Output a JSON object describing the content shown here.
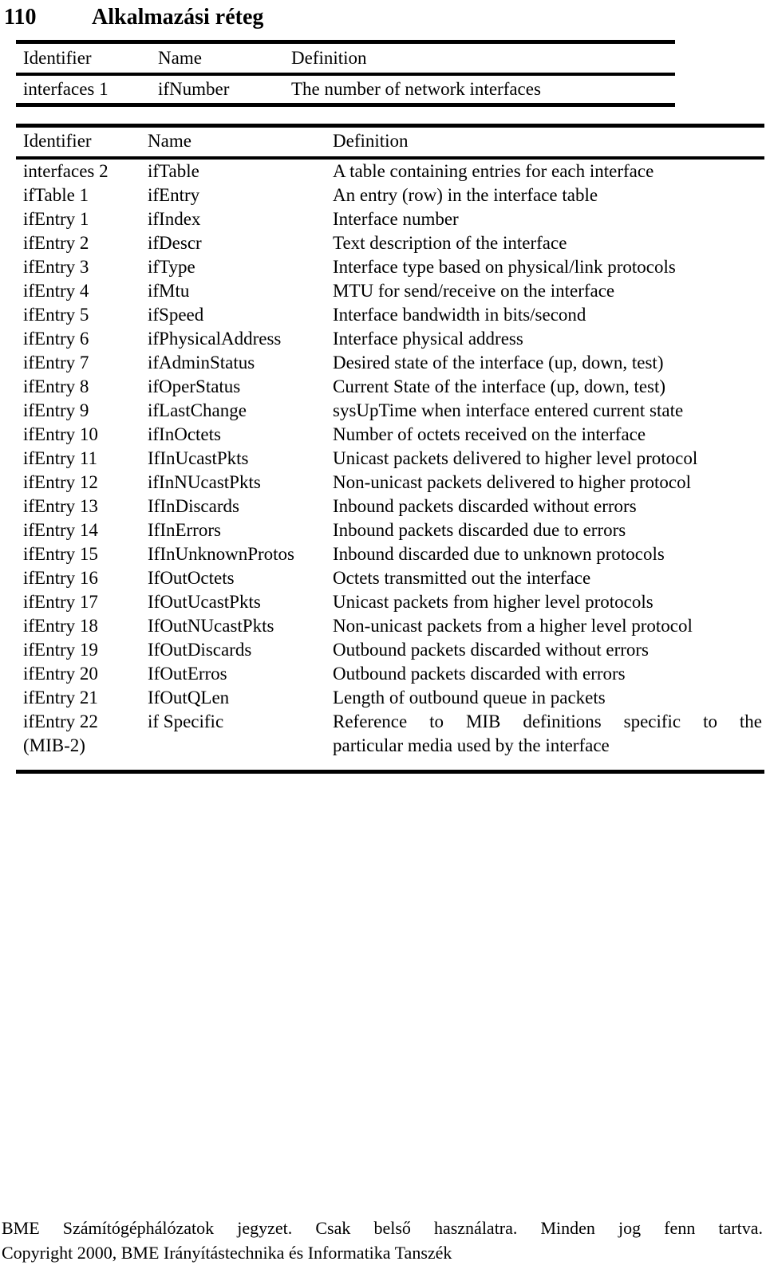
{
  "header": {
    "page_number": "110",
    "chapter_title": "Alkalmazási réteg"
  },
  "table_one": {
    "columns": [
      "Identifier",
      "Name",
      "Definition"
    ],
    "rows": [
      {
        "identifier": "interfaces 1",
        "name": "ifNumber",
        "definition": "The number of network interfaces"
      }
    ]
  },
  "table_two": {
    "columns": [
      "Identifier",
      "Name",
      "Definition"
    ],
    "rows": [
      {
        "identifier": "interfaces 2",
        "name": "ifTable",
        "definition": "A table containing entries for each interface"
      },
      {
        "identifier": "ifTable 1",
        "name": "ifEntry",
        "definition": "An entry (row) in the interface table"
      },
      {
        "identifier": "ifEntry 1",
        "name": "ifIndex",
        "definition": "Interface number"
      },
      {
        "identifier": "ifEntry 2",
        "name": "ifDescr",
        "definition": "Text description of the interface"
      },
      {
        "identifier": "ifEntry 3",
        "name": "ifType",
        "definition": "Interface type based on physical/link protocols"
      },
      {
        "identifier": "ifEntry 4",
        "name": "ifMtu",
        "definition": "MTU for send/receive on the interface"
      },
      {
        "identifier": "ifEntry 5",
        "name": "ifSpeed",
        "definition": "Interface bandwidth in bits/second"
      },
      {
        "identifier": "ifEntry 6",
        "name": "ifPhysicalAddress",
        "definition": "Interface physical address"
      },
      {
        "identifier": "ifEntry 7",
        "name": "ifAdminStatus",
        "definition": "Desired state of the interface (up, down, test)"
      },
      {
        "identifier": "ifEntry 8",
        "name": "ifOperStatus",
        "definition": "Current State of the interface (up, down, test)"
      },
      {
        "identifier": "ifEntry 9",
        "name": "ifLastChange",
        "definition": "sysUpTime when interface entered current state"
      },
      {
        "identifier": "ifEntry 10",
        "name": "ifInOctets",
        "definition": "Number of octets received on the interface"
      },
      {
        "identifier": "ifEntry 11",
        "name": "IfInUcastPkts",
        "definition": "Unicast packets delivered to higher level protocol"
      },
      {
        "identifier": "ifEntry 12",
        "name": "ifInNUcastPkts",
        "definition": "Non-unicast packets delivered to higher protocol"
      },
      {
        "identifier": "ifEntry 13",
        "name": "IfInDiscards",
        "definition": "Inbound packets discarded without errors"
      },
      {
        "identifier": "ifEntry 14",
        "name": "IfInErrors",
        "definition": "Inbound packets discarded due to errors"
      },
      {
        "identifier": "ifEntry 15",
        "name": "IfInUnknownProtos",
        "definition": "Inbound discarded due to unknown protocols"
      },
      {
        "identifier": "ifEntry 16",
        "name": "IfOutOctets",
        "definition": "Octets transmitted out the interface"
      },
      {
        "identifier": "ifEntry 17",
        "name": "IfOutUcastPkts",
        "definition": "Unicast packets from higher level protocols"
      },
      {
        "identifier": "ifEntry 18",
        "name": "IfOutNUcastPkts",
        "definition": "Non-unicast packets from a higher level protocol"
      },
      {
        "identifier": "ifEntry 19",
        "name": "IfOutDiscards",
        "definition": "Outbound packets discarded without errors"
      },
      {
        "identifier": "ifEntry 20",
        "name": "IfOutErros",
        "definition": "Outbound packets discarded with errors"
      },
      {
        "identifier": "ifEntry 21",
        "name": "IfOutQLen",
        "definition": "Length of outbound queue in packets"
      }
    ],
    "last_entry": {
      "identifier_line_one": "ifEntry 22",
      "identifier_line_two": "(MIB-2)",
      "name": "if Specific",
      "definition_line_one": "Reference to MIB definitions specific to the",
      "definition_line_two": "particular media used by the interface"
    }
  },
  "footer": {
    "line_one": "BME Számítógéphálózatok jegyzet. Csak belső használatra. Minden jog fenn tartva.",
    "line_two": "Copyright 2000, BME Irányítástechnika és Informatika Tanszék"
  }
}
